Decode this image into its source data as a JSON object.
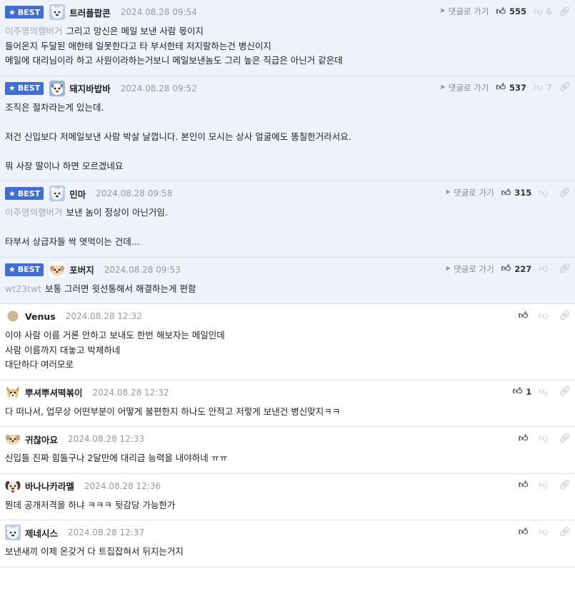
{
  "labels": {
    "best": "BEST",
    "reply": "댓글로 가기"
  },
  "comments": [
    {
      "best": true,
      "avatar": "blue-bear-avatar",
      "nick": "트러플팝콘",
      "date": "2024.08.28 09:54",
      "show_reply": true,
      "up": "555",
      "down": "6",
      "mention": "이주영의햄버거",
      "lines": [
        "그리고 망신은 메일 보낸 사람 몫이지",
        "들어온지 두달된 애한테 일못한다고 타 부서한테 저지랄하는건 병신이지",
        "메일에 대리님이라 하고 사원이라하는거보니 메일보낸놈도 그리 높은 직급은 아닌거 같은데"
      ]
    },
    {
      "best": true,
      "avatar": "dog-face-avatar",
      "nick": "돼지바밥바",
      "date": "2024.08.28 09:52",
      "show_reply": true,
      "up": "537",
      "down": "7",
      "mention": "",
      "lines": [
        "조직은 절차라는게 있는데.",
        "",
        "저건 신입보다 저메일보낸 사람 박살 날껍니다. 본인이 모시는 상사 얼굴에도 똥칠한거라서요.",
        "",
        "뭐 사장 딸이나 하면 모르겠네요"
      ]
    },
    {
      "best": true,
      "avatar": "blue-bear-avatar",
      "nick": "민마",
      "date": "2024.08.28 09:58",
      "show_reply": true,
      "up": "315",
      "down": "",
      "mention": "이주영의햄버거",
      "lines": [
        "보낸 놈이 정상이 아닌거임.",
        "",
        "타부서 상급자들 싹 엿먹이는 건데..."
      ]
    },
    {
      "best": true,
      "avatar": "puppy-avatar",
      "nick": "포버지",
      "date": "2024.08.28 09:53",
      "show_reply": true,
      "up": "227",
      "down": "",
      "mention": "wt23twt",
      "lines": [
        "보통 그러면 윗선통해서 해결하는게 편함"
      ]
    },
    {
      "best": false,
      "avatar": "gray-dot-avatar",
      "nick": "Venus",
      "date": "2024.08.28 12:32",
      "show_reply": false,
      "up": "",
      "down": "",
      "mention": "",
      "lines": [
        "이야 사람 이름 거론 안하고 보내도 한번 해보자는 메일인데",
        "사람 이름까지 대놓고 박제하네",
        "대단하다 여러모로"
      ]
    },
    {
      "best": false,
      "avatar": "fox-avatar",
      "nick": "뿌셔뿌셔떡볶이",
      "date": "2024.08.28 12:32",
      "show_reply": false,
      "up": "1",
      "down": "",
      "mention": "",
      "lines": [
        "다 떠나서, 업무상 어떤부분이 어떻게 불편한지 하나도 안적고 저렇게 보낸건 병신맞지ㅋㅋ"
      ]
    },
    {
      "best": false,
      "avatar": "puppy-avatar",
      "nick": "귀찮아요",
      "date": "2024.08.28 12:33",
      "show_reply": false,
      "up": "",
      "down": "",
      "mention": "",
      "lines": [
        "신입들 진짜 힘들구나 2달만에 대리급 능력을 내야하네 ㅠㅠ"
      ]
    },
    {
      "best": false,
      "avatar": "dark-dog-avatar",
      "nick": "바나나카라멜",
      "date": "2024.08.28 12:36",
      "show_reply": false,
      "up": "",
      "down": "",
      "mention": "",
      "lines": [
        "뭔데 공개저격을 하냐 ㅋㅋㅋ 뒷감당 가능한가"
      ]
    },
    {
      "best": false,
      "avatar": "blue-bear-avatar",
      "nick": "제네시스",
      "date": "2024.08.28 12:37",
      "show_reply": false,
      "up": "",
      "down": "",
      "mention": "",
      "lines": [
        "보낸새끼 이제 온갖거 다 트집잡혀서 뒤지는거지"
      ]
    }
  ],
  "icons": {
    "reply": "paper-plane-icon",
    "up": "thumbs-up-icon",
    "down": "thumbs-down-icon",
    "link": "link-icon"
  },
  "colors": {
    "best_bg": "#eef2fb",
    "badge": "#3f6fd6",
    "divider": "#dcdfe6",
    "mention": "#aaaaaa"
  }
}
